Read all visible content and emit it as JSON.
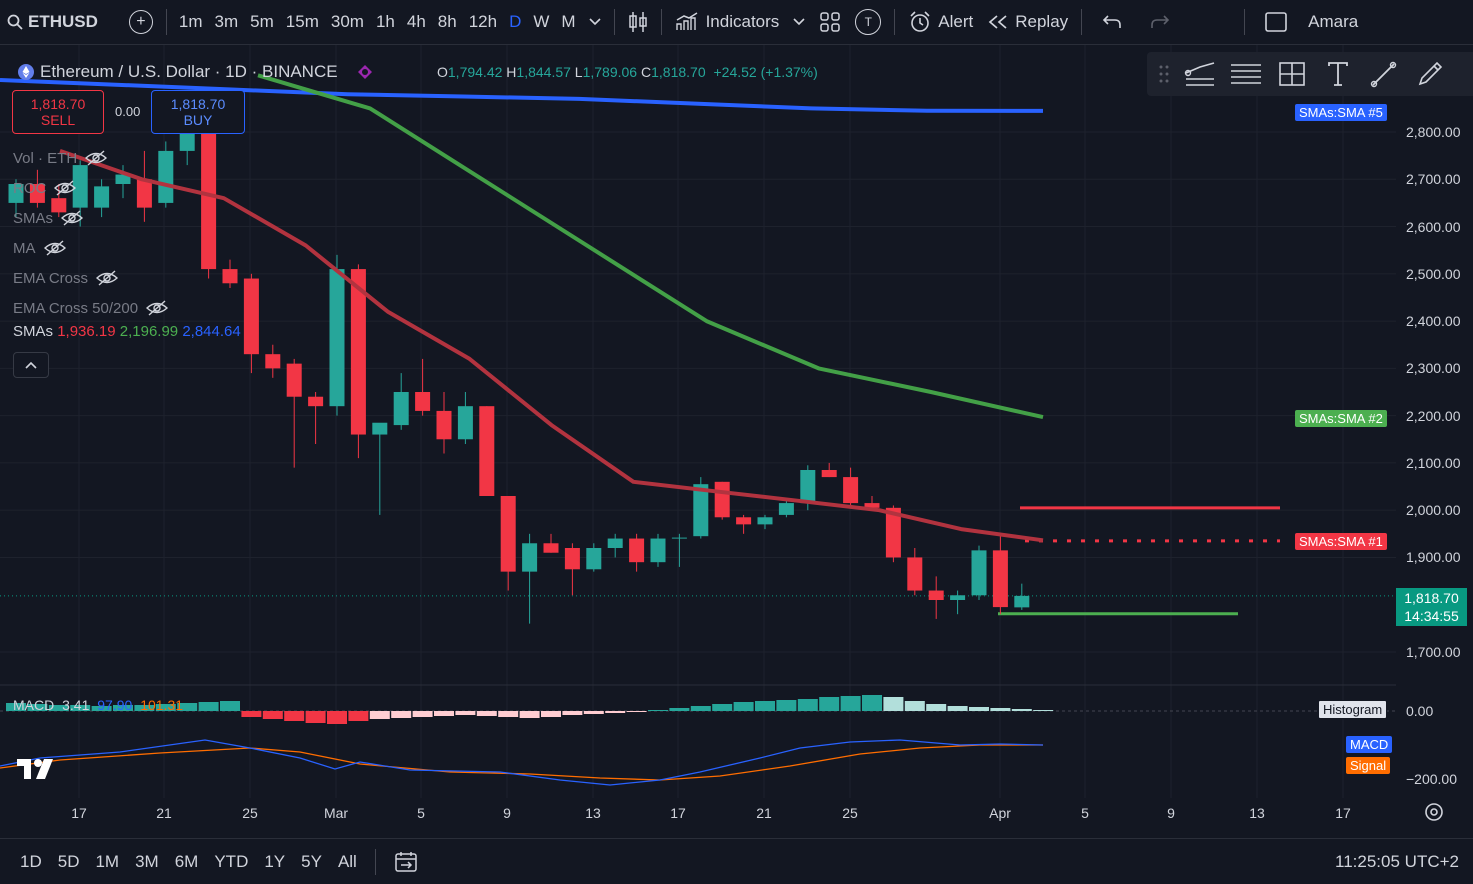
{
  "toolbar": {
    "symbol": "ETHUSD",
    "timeframes": [
      "1m",
      "3m",
      "5m",
      "15m",
      "30m",
      "1h",
      "4h",
      "8h",
      "12h",
      "D",
      "W",
      "M"
    ],
    "active_timeframe": "D",
    "indicators_label": "Indicators",
    "alert_label": "Alert",
    "replay_label": "Replay",
    "user_label": "Amara",
    "t_badge": "T"
  },
  "legend": {
    "title": "Ethereum / U.S. Dollar · 1D · BINANCE",
    "open_key": "O",
    "open": "1,794.42",
    "high_key": "H",
    "high": "1,844.57",
    "low_key": "L",
    "low": "1,789.06",
    "close_key": "C",
    "close": "1,818.70",
    "change": "+24.52 (+1.37%)"
  },
  "trade": {
    "sell_price": "1,818.70",
    "sell_label": "SELL",
    "spread": "0.00",
    "buy_price": "1,818.70",
    "buy_label": "BUY"
  },
  "indicators": [
    {
      "label": "Vol · ETH"
    },
    {
      "label": "ROC"
    },
    {
      "label": "SMAs"
    },
    {
      "label": "MA"
    },
    {
      "label": "EMA Cross"
    },
    {
      "label": "EMA Cross 50/200"
    }
  ],
  "smas_legend": {
    "label": "SMAs",
    "v1": "1,936.19",
    "v2": "2,196.99",
    "v3": "2,844.64"
  },
  "price_scale": {
    "ticks": [
      "2,800.00",
      "2,700.00",
      "2,600.00",
      "2,500.00",
      "2,400.00",
      "2,300.00",
      "2,200.00",
      "2,100.00",
      "2,000.00",
      "1,900.00",
      "1,700.00"
    ],
    "last_price": "1,818.70",
    "countdown": "14:34:55",
    "sma5_badge": "SMAs:SMA #5",
    "sma2_badge": "SMAs:SMA #2",
    "sma1_badge": "SMAs:SMA #1"
  },
  "macd": {
    "legend_label": "MACD",
    "v1": "3.41",
    "v2": "97.90",
    "v3": "101.31",
    "zero_tick": "0.00",
    "low_tick": "−200.00",
    "histogram_badge": "Histogram",
    "macd_badge": "MACD",
    "signal_badge": "Signal"
  },
  "time_axis": [
    "17",
    "21",
    "25",
    "Mar",
    "5",
    "9",
    "13",
    "17",
    "21",
    "25",
    "Apr",
    "5",
    "9",
    "13",
    "17"
  ],
  "bottom": {
    "ranges": [
      "1D",
      "5D",
      "1M",
      "3M",
      "6M",
      "YTD",
      "1Y",
      "5Y",
      "All"
    ],
    "clock": "11:25:05 UTC+2"
  },
  "colors": {
    "up": "#26a69a",
    "down": "#f23645",
    "sma5": "#2962ff",
    "sma2": "#43a047",
    "sma1": "#b2333f",
    "background": "#131722"
  },
  "chart_data": {
    "type": "candlestick",
    "ylim": [
      1650,
      2900
    ],
    "candles": [
      {
        "o": 2650,
        "h": 2700,
        "l": 2620,
        "c": 2690
      },
      {
        "o": 2690,
        "h": 2720,
        "l": 2640,
        "c": 2650
      },
      {
        "o": 2660,
        "h": 2690,
        "l": 2620,
        "c": 2630
      },
      {
        "o": 2640,
        "h": 2740,
        "l": 2600,
        "c": 2730
      },
      {
        "o": 2640,
        "h": 2700,
        "l": 2620,
        "c": 2685
      },
      {
        "o": 2690,
        "h": 2730,
        "l": 2660,
        "c": 2710
      },
      {
        "o": 2700,
        "h": 2760,
        "l": 2610,
        "c": 2640
      },
      {
        "o": 2650,
        "h": 2780,
        "l": 2640,
        "c": 2760
      },
      {
        "o": 2760,
        "h": 2820,
        "l": 2730,
        "c": 2800
      },
      {
        "o": 2800,
        "h": 2850,
        "l": 2490,
        "c": 2510
      },
      {
        "o": 2510,
        "h": 2530,
        "l": 2470,
        "c": 2480
      },
      {
        "o": 2490,
        "h": 2500,
        "l": 2290,
        "c": 2330
      },
      {
        "o": 2330,
        "h": 2350,
        "l": 2280,
        "c": 2300
      },
      {
        "o": 2310,
        "h": 2320,
        "l": 2090,
        "c": 2240
      },
      {
        "o": 2240,
        "h": 2250,
        "l": 2140,
        "c": 2220
      },
      {
        "o": 2220,
        "h": 2540,
        "l": 2200,
        "c": 2510
      },
      {
        "o": 2510,
        "h": 2520,
        "l": 2110,
        "c": 2160
      },
      {
        "o": 2160,
        "h": 2180,
        "l": 1990,
        "c": 2185
      },
      {
        "o": 2180,
        "h": 2290,
        "l": 2170,
        "c": 2250
      },
      {
        "o": 2250,
        "h": 2320,
        "l": 2200,
        "c": 2210
      },
      {
        "o": 2210,
        "h": 2250,
        "l": 2120,
        "c": 2150
      },
      {
        "o": 2150,
        "h": 2250,
        "l": 2140,
        "c": 2220
      },
      {
        "o": 2220,
        "h": 2220,
        "l": 2030,
        "c": 2030
      },
      {
        "o": 2030,
        "h": 2030,
        "l": 1830,
        "c": 1870
      },
      {
        "o": 1870,
        "h": 1950,
        "l": 1760,
        "c": 1930
      },
      {
        "o": 1930,
        "h": 1950,
        "l": 1910,
        "c": 1910
      },
      {
        "o": 1920,
        "h": 1930,
        "l": 1820,
        "c": 1875
      },
      {
        "o": 1875,
        "h": 1930,
        "l": 1870,
        "c": 1920
      },
      {
        "o": 1920,
        "h": 1950,
        "l": 1900,
        "c": 1940
      },
      {
        "o": 1940,
        "h": 1950,
        "l": 1870,
        "c": 1890
      },
      {
        "o": 1890,
        "h": 1950,
        "l": 1880,
        "c": 1940
      },
      {
        "o": 1940,
        "h": 1950,
        "l": 1880,
        "c": 1942
      },
      {
        "o": 1945,
        "h": 2070,
        "l": 1940,
        "c": 2055
      },
      {
        "o": 2060,
        "h": 2060,
        "l": 1980,
        "c": 1985
      },
      {
        "o": 1985,
        "h": 1990,
        "l": 1950,
        "c": 1970
      },
      {
        "o": 1970,
        "h": 1990,
        "l": 1960,
        "c": 1985
      },
      {
        "o": 1990,
        "h": 2020,
        "l": 1985,
        "c": 2015
      },
      {
        "o": 2015,
        "h": 2095,
        "l": 2000,
        "c": 2085
      },
      {
        "o": 2085,
        "h": 2100,
        "l": 2070,
        "c": 2070
      },
      {
        "o": 2070,
        "h": 2090,
        "l": 2010,
        "c": 2015
      },
      {
        "o": 2015,
        "h": 2030,
        "l": 2000,
        "c": 2005
      },
      {
        "o": 2005,
        "h": 2010,
        "l": 1890,
        "c": 1900
      },
      {
        "o": 1900,
        "h": 1920,
        "l": 1820,
        "c": 1830
      },
      {
        "o": 1830,
        "h": 1860,
        "l": 1770,
        "c": 1810
      },
      {
        "o": 1810,
        "h": 1830,
        "l": 1780,
        "c": 1820
      },
      {
        "o": 1820,
        "h": 1925,
        "l": 1810,
        "c": 1915
      },
      {
        "o": 1915,
        "h": 1945,
        "l": 1780,
        "c": 1795
      },
      {
        "o": 1794.42,
        "h": 1844.57,
        "l": 1789.06,
        "c": 1818.7
      }
    ],
    "sma5": [
      2910,
      2900,
      2890,
      2880,
      2875,
      2870,
      2860,
      2850,
      2845,
      2844.64
    ],
    "sma2": [
      2920,
      2850,
      2700,
      2550,
      2400,
      2300,
      2250,
      2196.99
    ],
    "sma1": [
      2760,
      2700,
      2660,
      2560,
      2420,
      2320,
      2180,
      2060,
      2040,
      2020,
      2000,
      1960,
      1936.19
    ],
    "horizontal_lines": [
      {
        "price": 2005,
        "color": "#f23645",
        "style": "solid"
      },
      {
        "price": 1935,
        "color": "#f23645",
        "style": "dotted"
      },
      {
        "price": 1781,
        "color": "#4caf50",
        "style": "solid"
      }
    ]
  }
}
